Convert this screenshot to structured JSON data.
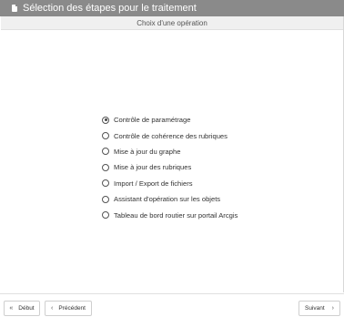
{
  "window": {
    "title": "Sélection des étapes pour le traitement",
    "title_icon": "document-icon"
  },
  "subheader": {
    "label": "Choix d'une opération"
  },
  "options": [
    {
      "label": "Contrôle de paramétrage",
      "selected": true
    },
    {
      "label": "Contrôle de cohérence des rubriques",
      "selected": false
    },
    {
      "label": "Mise à jour du graphe",
      "selected": false
    },
    {
      "label": "Mise à jour des rubriques",
      "selected": false
    },
    {
      "label": "Import / Export de fichiers",
      "selected": false
    },
    {
      "label": "Assistant d'opération sur les objets",
      "selected": false
    },
    {
      "label": "Tableau de bord routier sur portail Arcgis",
      "selected": false
    }
  ],
  "footer": {
    "first_label": "Début",
    "first_icon": "double-chevron-left-icon",
    "prev_label": "Précédent",
    "prev_icon": "chevron-left-icon",
    "next_label": "Suivant",
    "next_icon": "chevron-right-icon"
  },
  "colors": {
    "titlebar_bg": "#8a8a8a",
    "subheader_bg": "#f0f0f0"
  }
}
